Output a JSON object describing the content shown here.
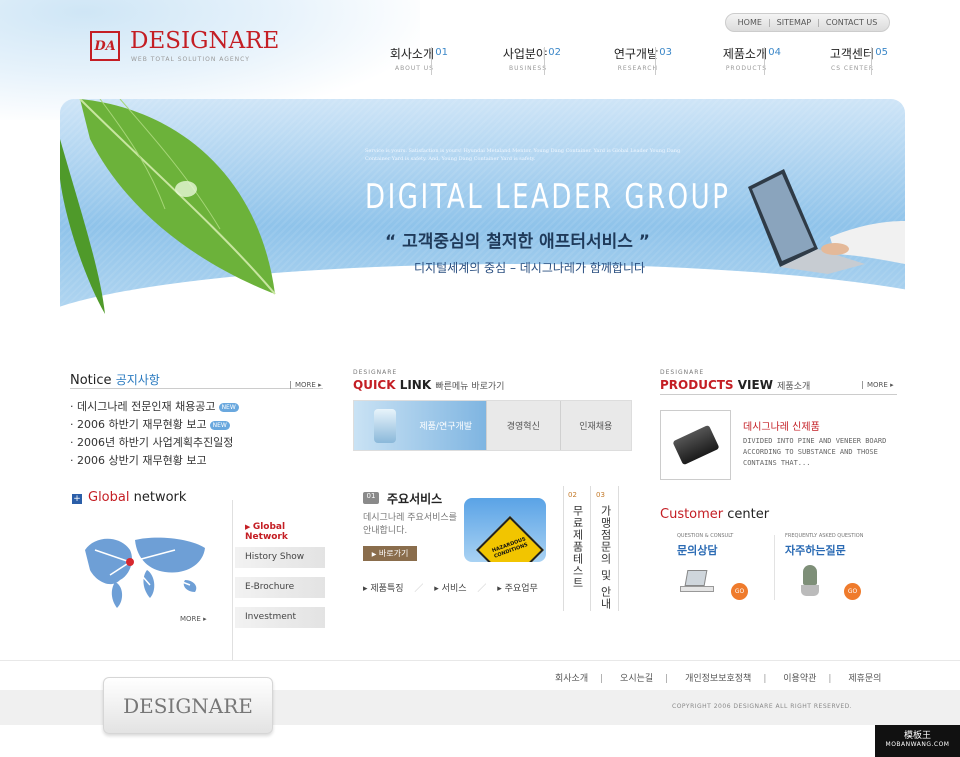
{
  "brand": {
    "logo_mark": "DA",
    "name": "DESIGNARE",
    "tagline": "WEB TOTAL SOLUTION AGENCY"
  },
  "util_nav": [
    "HOME",
    "SITEMAP",
    "CONTACT US"
  ],
  "main_nav": [
    {
      "ko": "회사소개",
      "en": "ABOUT US",
      "num": "01"
    },
    {
      "ko": "사업분야",
      "en": "BUSINESS",
      "num": "02"
    },
    {
      "ko": "연구개발",
      "en": "RESEARCH",
      "num": "03"
    },
    {
      "ko": "제품소개",
      "en": "PRODUCTS",
      "num": "04"
    },
    {
      "ko": "고객센터",
      "en": "CS CENTER",
      "num": "05"
    }
  ],
  "hero": {
    "tiny_text": "Service is yours. Satisfaction is yours! Hyundai Metaland Mentor. Young Dang Container. Yard is Global Leader Young Dang Container Yard is safety. And, Young Dang Container Yard is safety.",
    "title": "DIGITAL LEADER GROUP",
    "quote": "“ 고객중심의 철저한 애프터서비스 ”",
    "subtitle": "디지털세계의 중심 – 데시그나레가 함께합니다"
  },
  "notice": {
    "title_en": "Notice",
    "title_ko": "공지사항",
    "more": "MORE",
    "items": [
      {
        "text": "데시그나레 전문인재 채용공고",
        "new": "NEW"
      },
      {
        "text": "2006 하반기 재무현황 보고",
        "new": "NEW"
      },
      {
        "text": "2006년 하반기 사업계획추진일정",
        "new": ""
      },
      {
        "text": "2006 상반기 재무현황 보고",
        "new": ""
      }
    ]
  },
  "global": {
    "title_red": "Global",
    "title_rest": " network",
    "more": "MORE",
    "menu": [
      "Global Network",
      "History Show",
      "E-Brochure",
      "Investment"
    ]
  },
  "quick_link": {
    "small": "DESIGNARE",
    "title_red": "QUICK",
    "title_rest": " LINK",
    "subtitle": "빠른메뉴 바로가기",
    "tabs": [
      "제품/연구개발",
      "경영혁신",
      "인재채용"
    ]
  },
  "service": {
    "num": "01",
    "title": "주요서비스",
    "desc": "데시그나레 주요서비스를 안내합니다.",
    "button": "바로가기",
    "sign": "HAZARDOUS CONDITIONS",
    "links": [
      "제품특징",
      "서비스",
      "주요업무"
    ],
    "vertical": [
      {
        "num": "02",
        "text": "무료제품테스트"
      },
      {
        "num": "03",
        "text": "가맹점문의 및 안내"
      }
    ]
  },
  "products": {
    "small": "DESIGNARE",
    "title_red": "PRODUCTS",
    "title_rest": " VIEW",
    "subtitle": "제품소개",
    "more": "MORE",
    "item_title": "데시그나레 신제품",
    "item_desc": "DIVIDED INTO PINE AND VENEER BOARD ACCORDING TO SUBSTANCE AND THOSE CONTAINS THAT..."
  },
  "customer": {
    "title_red": "Customer",
    "title_rest": " center",
    "items": [
      {
        "small": "QUESTION & CONSULT",
        "title": "문의상담",
        "go": "GO"
      },
      {
        "small": "FREQUENTLY ASKED QUESTION",
        "title": "자주하는질문",
        "go": "GO"
      }
    ]
  },
  "footer": {
    "logo": "DESIGNARE",
    "links": [
      "회사소개",
      "오시는길",
      "개인정보보호정책",
      "이용약관",
      "제휴문의"
    ],
    "copyright": "COPYRIGHT 2006 DESIGNARE ALL RIGHT RESERVED.",
    "badge_ko": "模板王",
    "badge_en": "MOBANWANG.COM"
  },
  "colors": {
    "brand_red": "#c41e24",
    "accent_blue": "#2b7bc0",
    "go_orange": "#ef7b2c"
  }
}
